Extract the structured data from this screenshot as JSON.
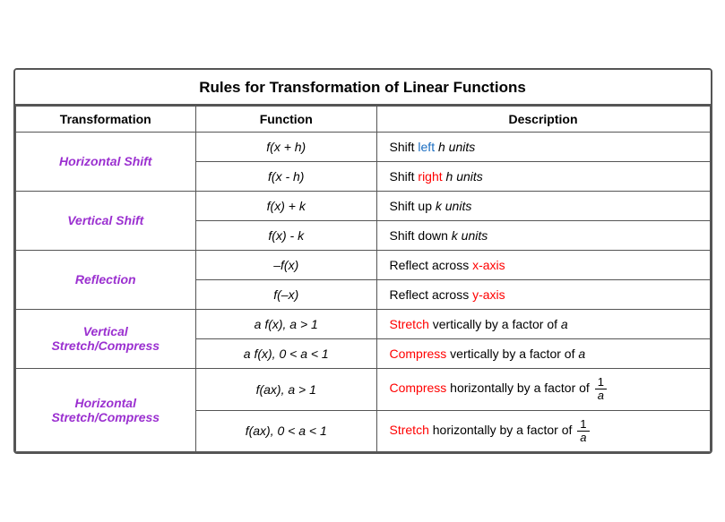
{
  "title": "Rules for Transformation of Linear Functions",
  "columns": [
    "Transformation",
    "Function",
    "Description"
  ],
  "rows": [
    {
      "transform": "Horizontal Shift",
      "transform_color": "#9b30d0",
      "rowspan": 2,
      "functions": [
        "f(x + h)",
        "f(x  - h)"
      ],
      "descriptions": [
        {
          "parts": [
            {
              "text": "Shift ",
              "color": null
            },
            {
              "text": "left",
              "color": "blue"
            },
            {
              "text": " h units",
              "color": null,
              "italic": true
            }
          ]
        },
        {
          "parts": [
            {
              "text": "Shift ",
              "color": null
            },
            {
              "text": "right",
              "color": "red"
            },
            {
              "text": " h units",
              "color": null,
              "italic": true
            }
          ]
        }
      ]
    },
    {
      "transform": "Vertical Shift",
      "transform_color": "#9b30d0",
      "rowspan": 2,
      "functions": [
        "f(x) + k",
        "f(x) - k"
      ],
      "descriptions": [
        {
          "parts": [
            {
              "text": "Shift ",
              "color": null
            },
            {
              "text": "up",
              "color": null
            },
            {
              "text": " k units",
              "color": null,
              "italic": true
            }
          ]
        },
        {
          "parts": [
            {
              "text": "Shift ",
              "color": null
            },
            {
              "text": "down",
              "color": null
            },
            {
              "text": " k units",
              "color": null,
              "italic": true
            }
          ]
        }
      ]
    },
    {
      "transform": "Reflection",
      "transform_color": "#9b30d0",
      "rowspan": 2,
      "functions": [
        "–f(x)",
        "f(–x)"
      ],
      "descriptions": [
        {
          "parts": [
            {
              "text": "Reflect across ",
              "color": null
            },
            {
              "text": "x-axis",
              "color": "red"
            }
          ]
        },
        {
          "parts": [
            {
              "text": "Reflect across ",
              "color": null
            },
            {
              "text": "y-axis",
              "color": "red"
            }
          ]
        }
      ]
    },
    {
      "transform": "Vertical Stretch/Compress",
      "transform_color": "#9b30d0",
      "rowspan": 2,
      "functions": [
        "a f(x), a > 1",
        "a f(x), 0 < a < 1"
      ],
      "descriptions": [
        {
          "parts": [
            {
              "text": "Stretch",
              "color": "red"
            },
            {
              "text": " vertically by a factor of ",
              "color": null
            },
            {
              "text": "a",
              "color": null,
              "italic": true
            }
          ]
        },
        {
          "parts": [
            {
              "text": "Compress",
              "color": "red"
            },
            {
              "text": " vertically by a factor of ",
              "color": null
            },
            {
              "text": "a",
              "color": null,
              "italic": true
            }
          ]
        }
      ]
    },
    {
      "transform": "Horizontal Stretch/Compress",
      "transform_color": "#9b30d0",
      "rowspan": 2,
      "functions": [
        "f(ax), a > 1",
        "f(ax), 0 < a < 1"
      ],
      "descriptions": [
        {
          "type": "fraction",
          "prefix_color": "red",
          "prefix": "Compress",
          "middle": " horizontally by a factor of ",
          "fraction_num": "1",
          "fraction_den": "a"
        },
        {
          "type": "fraction",
          "prefix_color": "red",
          "prefix": "Stretch",
          "middle": " horizontally by a factor of ",
          "fraction_num": "1",
          "fraction_den": "a"
        }
      ]
    }
  ]
}
